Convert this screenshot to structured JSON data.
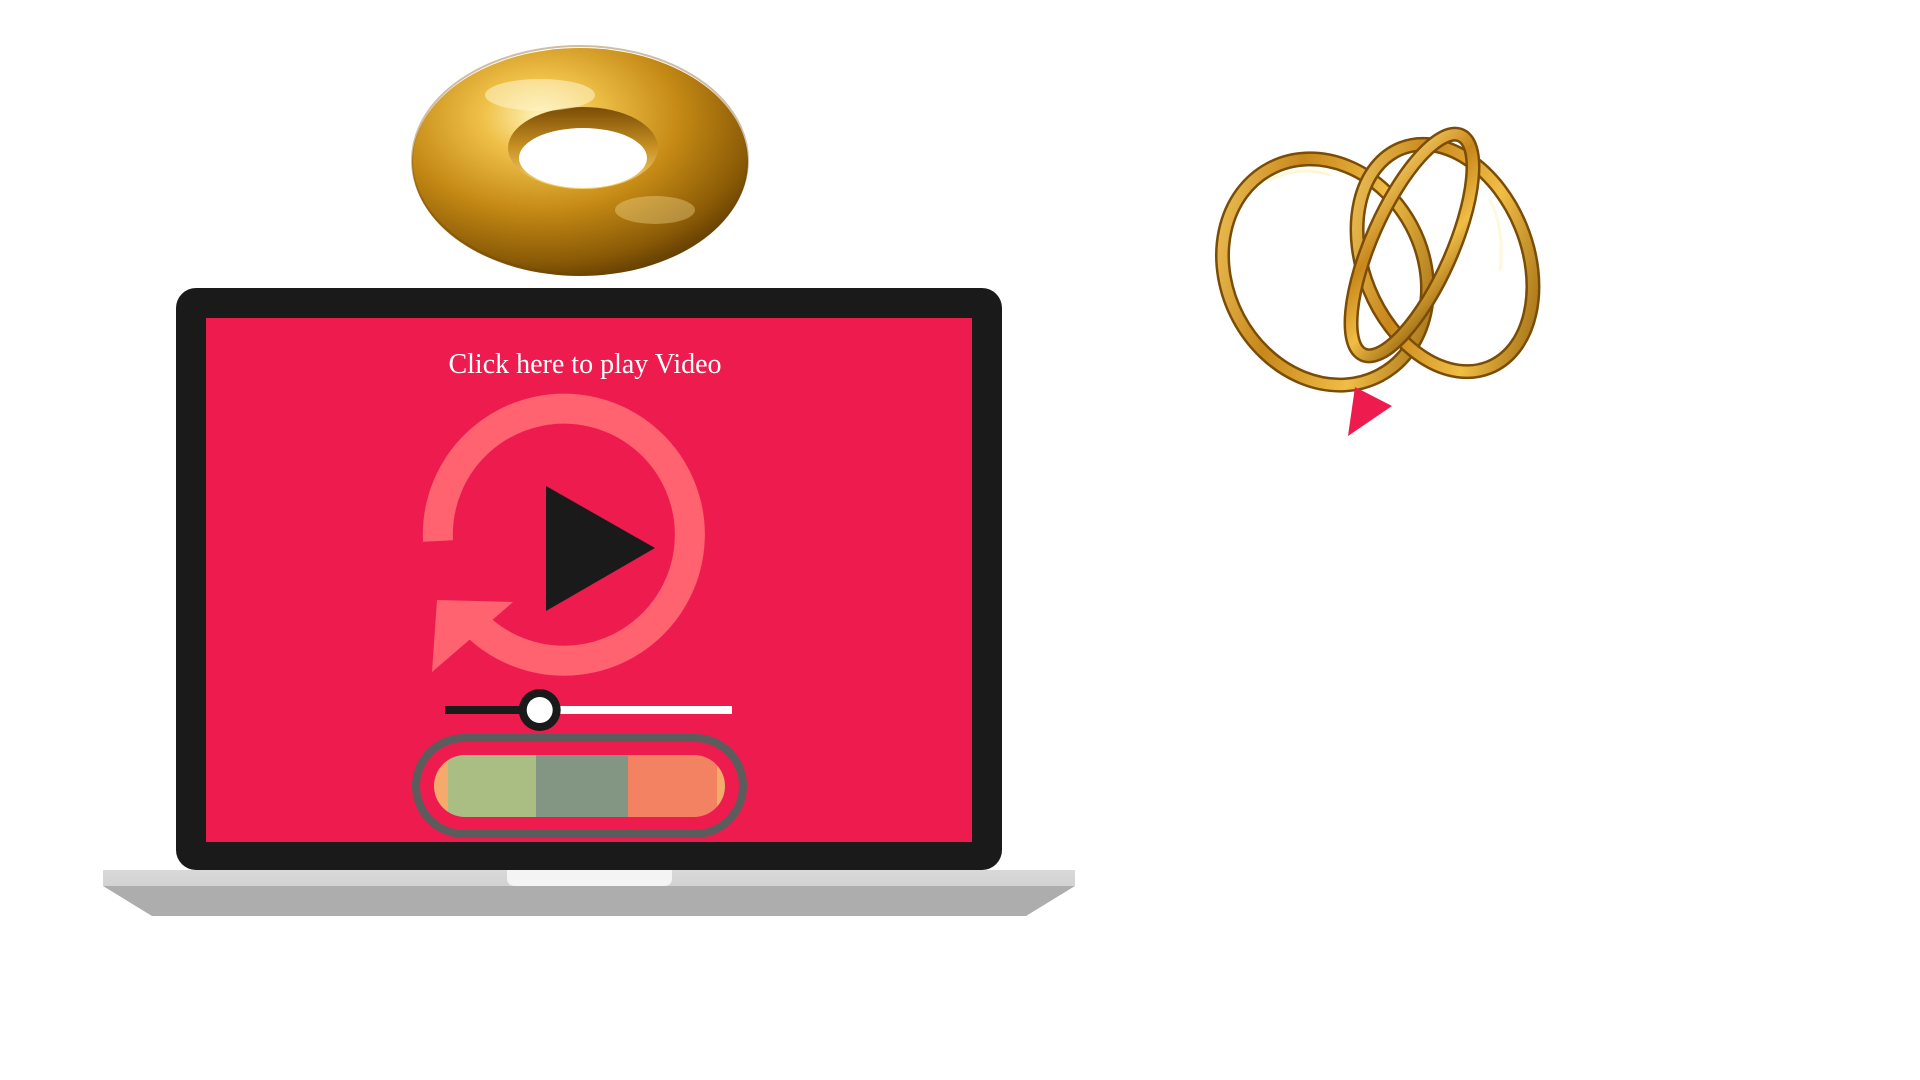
{
  "screen": {
    "caption": "Click here to play Video"
  },
  "colors": {
    "background": "#ffffff",
    "screen": "#ee1c4e",
    "bezel": "#1a1a1a",
    "laptop_base_top": "#d9d9d9",
    "laptop_base_bottom": "#adadad",
    "replay_ring": "#ff6370",
    "play_triangle": "#1a1a1a",
    "slider_filled": "#1a1a1a",
    "slider_track": "#ffffff",
    "gold": "#c98a17",
    "cursor": "#ee1c4e",
    "palette_frame": "#5c5c5c",
    "palette_swatches": [
      "#f3aa6b",
      "#aabd82",
      "#839683",
      "#f28261",
      "#f3aa6b"
    ]
  },
  "icons": {
    "replay": "replay-icon",
    "play": "play-icon",
    "torus": "gold-torus-icon",
    "knot": "gold-knot-icon",
    "cursor": "pointer-cursor-icon"
  },
  "player": {
    "progress_fraction": 0.33
  }
}
